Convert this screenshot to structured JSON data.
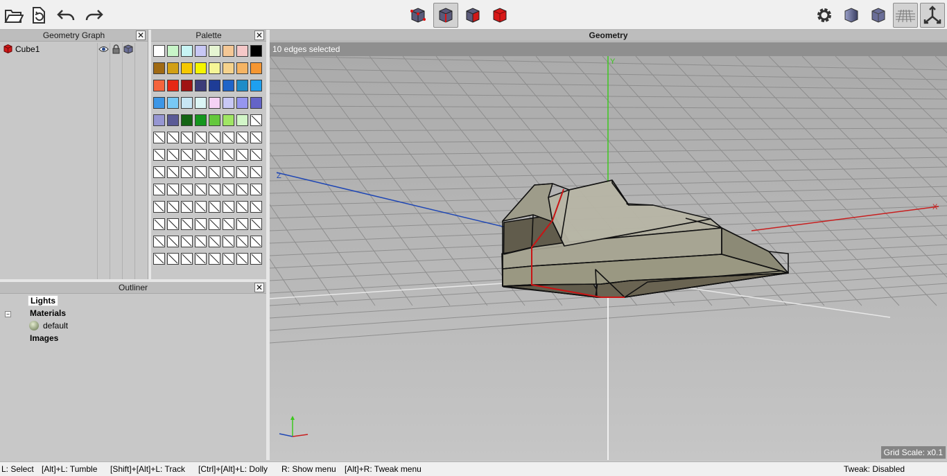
{
  "panels": {
    "geometry_graph": {
      "title": "Geometry Graph",
      "close": "✕"
    },
    "palette": {
      "title": "Palette",
      "close": "✕"
    },
    "outliner": {
      "title": "Outliner",
      "close": "✕"
    },
    "viewport": {
      "title": "Geometry"
    }
  },
  "geometry_graph": {
    "items": [
      {
        "name": "Cube1",
        "icon": "red-cube-icon",
        "visible_icon": "eye-icon",
        "lock_icon": "lock-icon",
        "shading_icon": "cube-shading-icon"
      }
    ]
  },
  "palette": {
    "colors": [
      "#ffffff",
      "#c8f5c8",
      "#c8f5f5",
      "#c8c8f5",
      "#e6f5d2",
      "#f5c896",
      "#f5c8c8",
      "#000000",
      "#a06a14",
      "#d2a014",
      "#f5c800",
      "#f5f500",
      "#f5f596",
      "#f5d28c",
      "#f5b464",
      "#f59632",
      "#f5643c",
      "#e62814",
      "#a01414",
      "#3c3c78",
      "#1e3c96",
      "#1e64c8",
      "#1e8cc8",
      "#1ea0f0",
      "#3c96e6",
      "#78c8f5",
      "#c8e6f5",
      "#dcf5f5",
      "#f5d2f5",
      "#c8c8f5",
      "#9696f0",
      "#6464c8",
      "#9696d2",
      "#5a5a96",
      "#146414",
      "#14961e",
      "#64c83c",
      "#a0e664",
      "#d2f5c8"
    ],
    "total_cells": 104
  },
  "outliner": {
    "lights": "Lights",
    "materials": "Materials",
    "default_material": "default",
    "images": "Images",
    "toggle": "−"
  },
  "viewport": {
    "selection_info": "10 edges selected",
    "grid_scale": "Grid Scale: x0.1",
    "axis_x": "X",
    "axis_y": "Y",
    "axis_z": "Z"
  },
  "toolbar": {
    "left": [
      "open-icon",
      "revert-icon",
      "undo-icon",
      "redo-icon"
    ],
    "center": [
      "vertex-select-icon",
      "edge-select-icon",
      "face-select-icon",
      "body-select-icon"
    ],
    "right": [
      "preferences-icon",
      "smooth-preview-icon",
      "flat-preview-icon",
      "ground-grid-icon",
      "axes-icon"
    ],
    "active_center_index": 1
  },
  "statusbar": {
    "select": "L: Select",
    "tumble": "[Alt]+L: Tumble",
    "track": "[Shift]+[Alt]+L: Track",
    "dolly": "[Ctrl]+[Alt]+L: Dolly",
    "show_menu": "R: Show menu",
    "tweak_menu": "[Alt]+R: Tweak menu",
    "tweak_status": "Tweak: Disabled"
  },
  "colors": {
    "edge_selected": "#c81414",
    "axis_x": "#c81e1e",
    "axis_y": "#3cc81e",
    "axis_z": "#1e46b4",
    "mesh_fill": "#8c8c78"
  }
}
